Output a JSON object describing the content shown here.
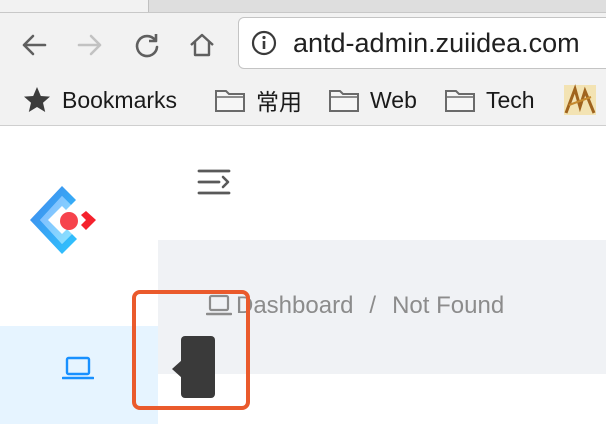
{
  "browser": {
    "url": "antd-admin.zuiidea.com",
    "nav": [
      "back-icon",
      "forward-icon",
      "reload-icon",
      "home-icon"
    ],
    "bookmarks": [
      {
        "label": "Bookmarks",
        "icon": "star-icon"
      },
      {
        "label": "常用",
        "icon": "folder-icon"
      },
      {
        "label": "Web",
        "icon": "folder-icon"
      },
      {
        "label": "Tech",
        "icon": "folder-icon"
      }
    ]
  },
  "app": {
    "menu_selected_icon": "laptop-icon",
    "breadcrumb": {
      "home": "Dashboard",
      "separator": "/",
      "current": "Not Found"
    }
  },
  "colors": {
    "primary": "#1890ff",
    "logo_red": "#f5222d",
    "highlight": "#ea5a2c",
    "content_bg": "#f0f2f5",
    "menu_selected_bg": "#e6f4ff"
  }
}
